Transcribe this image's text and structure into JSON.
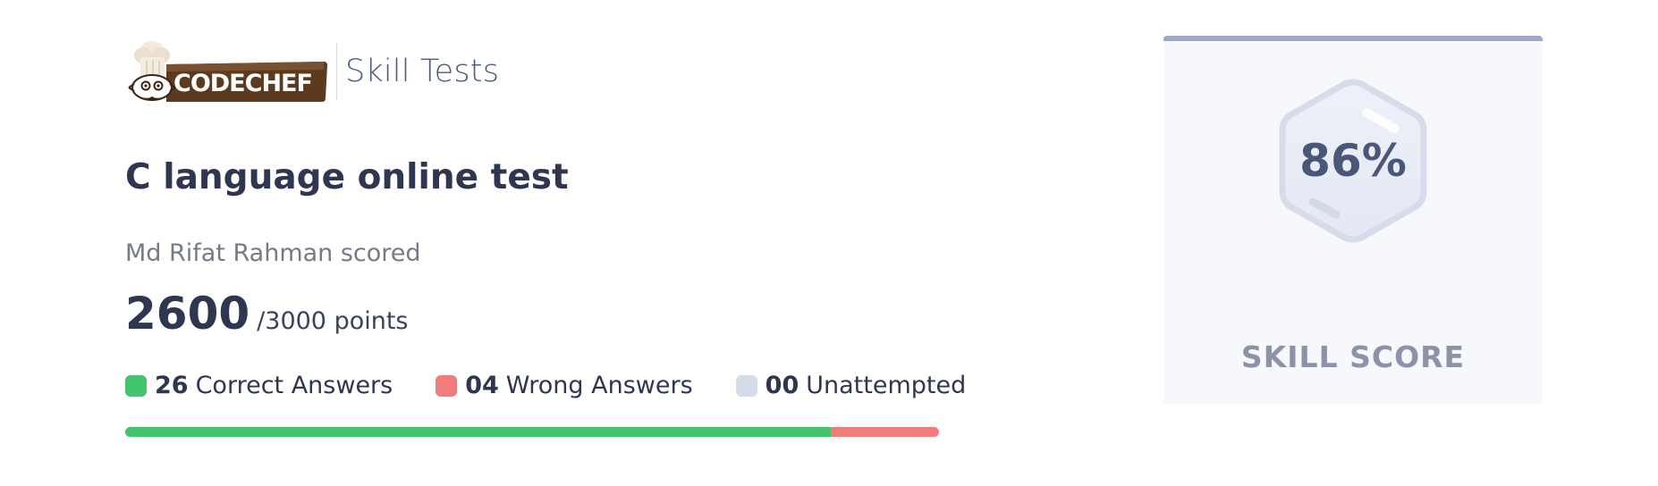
{
  "brand": {
    "logo_text": "CODECHEF",
    "product": "Skill Tests"
  },
  "test": {
    "title": "C language online test",
    "scored_by": "Md Rifat Rahman scored",
    "score": "2600",
    "score_total": "/3000 points"
  },
  "legend": {
    "correct": {
      "count": "26",
      "label": "Correct Answers",
      "color": "#41c46d"
    },
    "wrong": {
      "count": "04",
      "label": "Wrong Answers",
      "color": "#f27c7c"
    },
    "unattempted": {
      "count": "00",
      "label": "Unattempted",
      "color": "#d5dbe8"
    }
  },
  "progress": {
    "correct_fraction": 0.8667,
    "wrong_fraction": 0.1333,
    "unattempted_fraction": 0
  },
  "skill_score": {
    "percent": "86%",
    "label": "SKILL SCORE"
  },
  "icons": {
    "logo": "codechef-chef-hat-logo",
    "badge": "hexagon-badge-icon"
  }
}
